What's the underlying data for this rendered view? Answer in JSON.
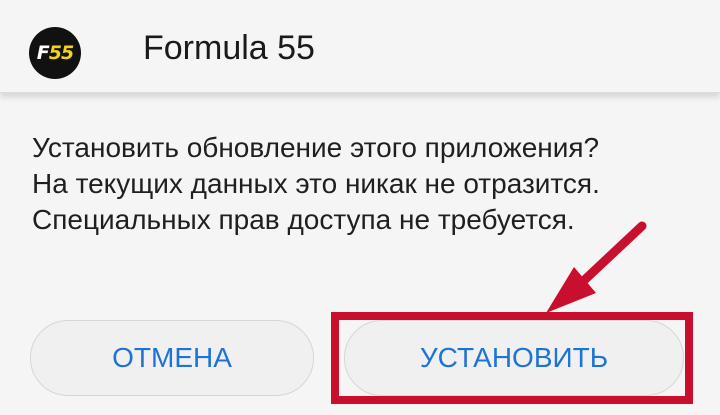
{
  "header": {
    "app_name": "Formula 55",
    "logo_letter": "F",
    "logo_number": "55"
  },
  "dialog": {
    "message_lines": [
      "Установить обновление этого приложения?",
      "На текущих данных это никак не отразится.",
      "Специальных прав доступа не требуется."
    ],
    "cancel_label": "ОТМЕНА",
    "install_label": "УСТАНОВИТЬ"
  },
  "colors": {
    "background": "#f5f5f5",
    "button_text": "#1e74d6",
    "highlight": "#c8102e",
    "logo_accent": "#f3d21a"
  },
  "icons": {
    "app": "formula-55-logo-icon",
    "annotation": "red-arrow-icon"
  }
}
